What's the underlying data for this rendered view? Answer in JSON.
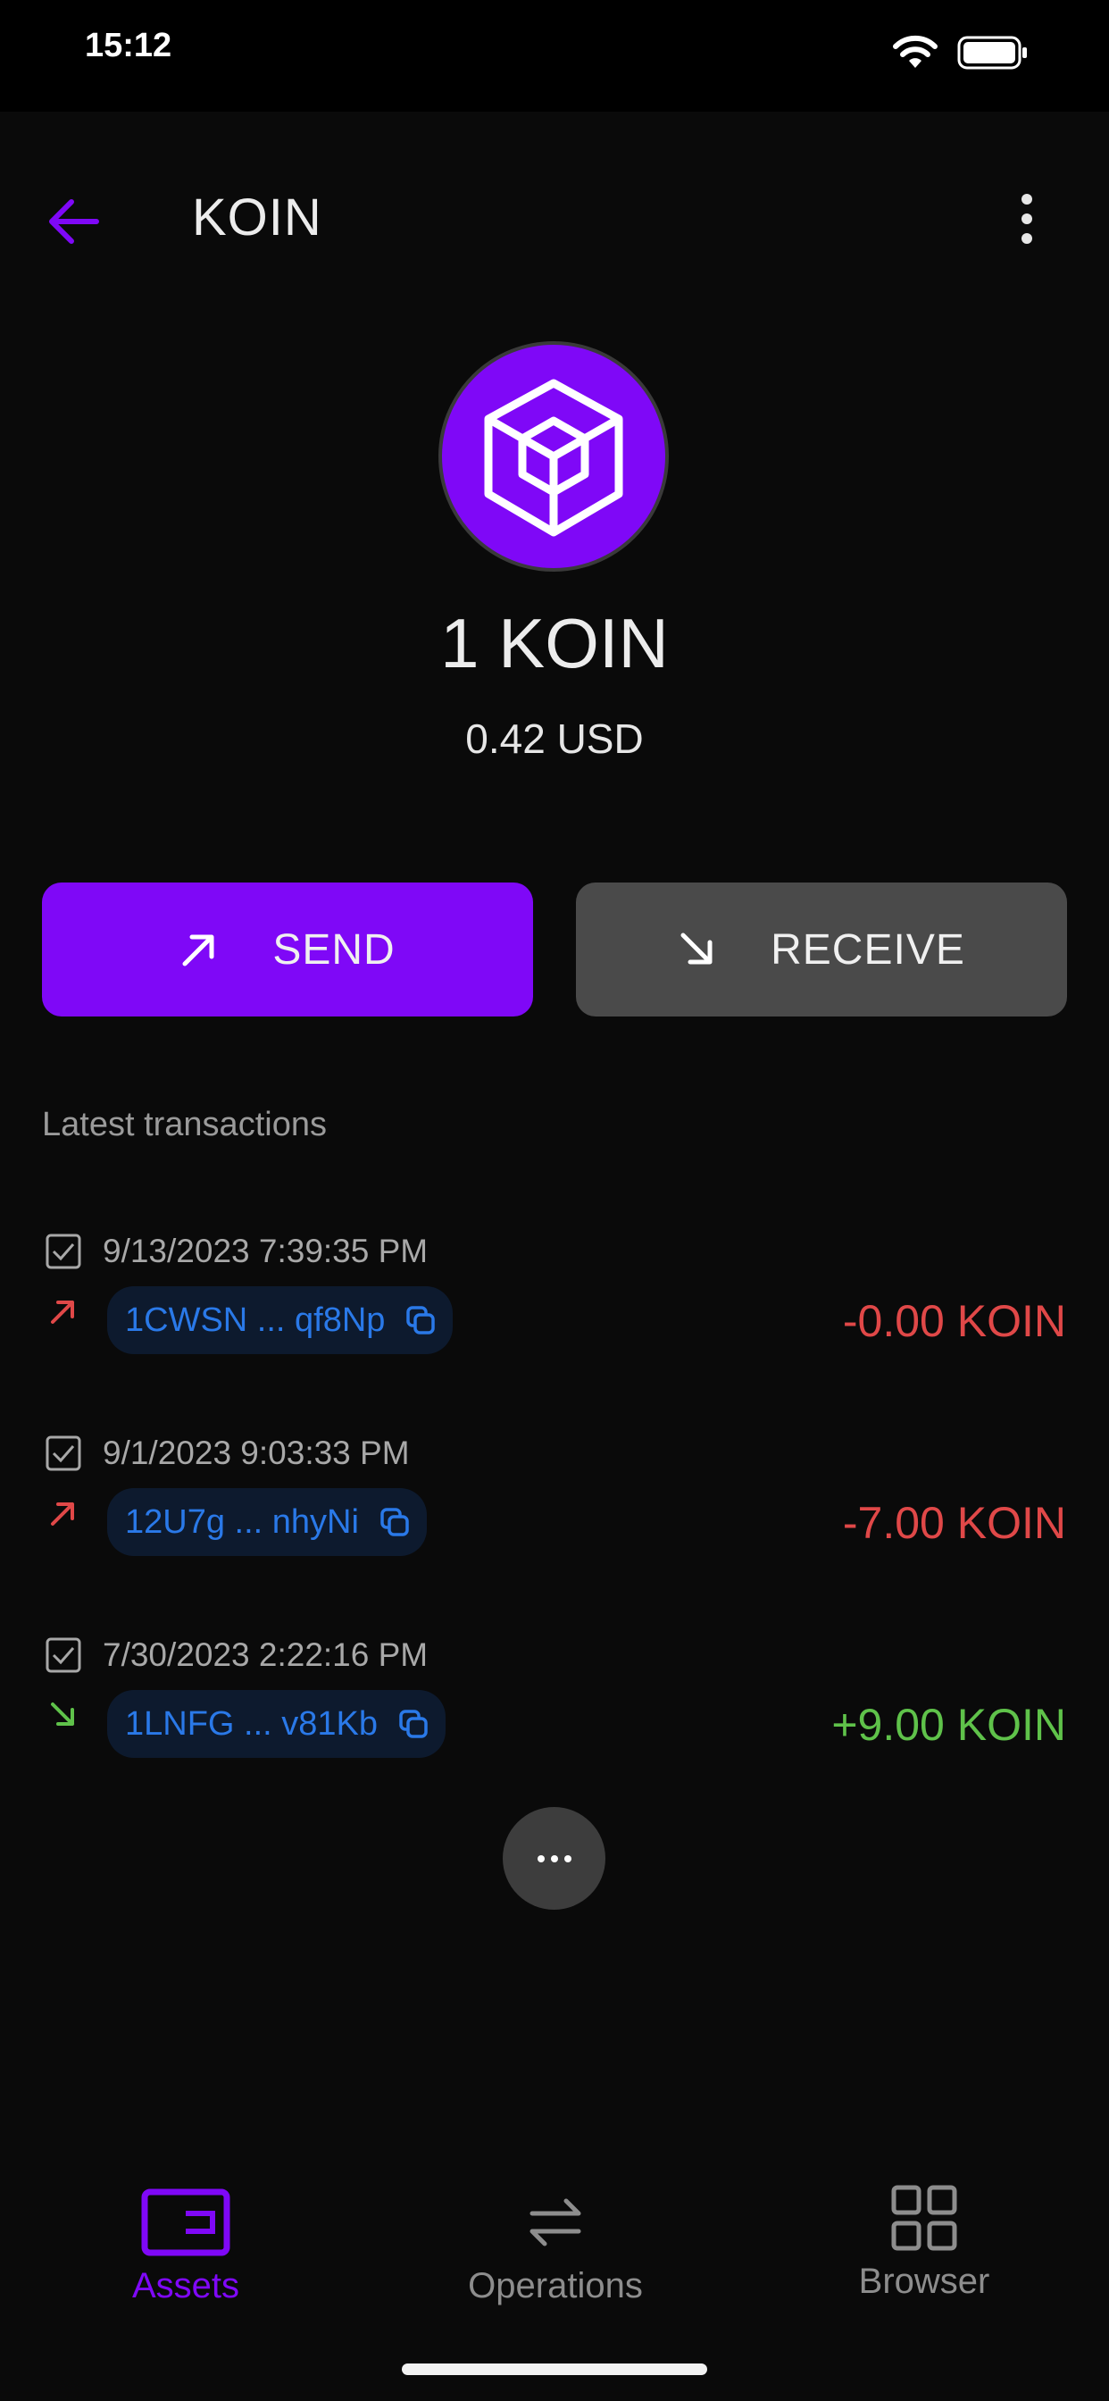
{
  "status": {
    "time": "15:12"
  },
  "header": {
    "title": "KOIN"
  },
  "token": {
    "balance": "1 KOIN",
    "fiat": "0.42 USD",
    "logo_color": "#7f08f7"
  },
  "actions": {
    "send_label": "SEND",
    "receive_label": "RECEIVE"
  },
  "transactions": {
    "section_title": "Latest transactions",
    "items": [
      {
        "date": "9/13/2023 7:39:35 PM",
        "address": "1CWSN ... qf8Np",
        "amount": "-0.00 KOIN",
        "direction": "out"
      },
      {
        "date": "9/1/2023 9:03:33 PM",
        "address": "12U7g ... nhyNi",
        "amount": "-7.00 KOIN",
        "direction": "out"
      },
      {
        "date": "7/30/2023 2:22:16 PM",
        "address": "1LNFG ... v81Kb",
        "amount": "+9.00 KOIN",
        "direction": "in"
      }
    ]
  },
  "tabs": {
    "assets": "Assets",
    "operations": "Operations",
    "browser": "Browser"
  },
  "colors": {
    "accent": "#7f08f7",
    "negative": "#e04848",
    "positive": "#5fc24a",
    "link": "#2a79e8"
  }
}
